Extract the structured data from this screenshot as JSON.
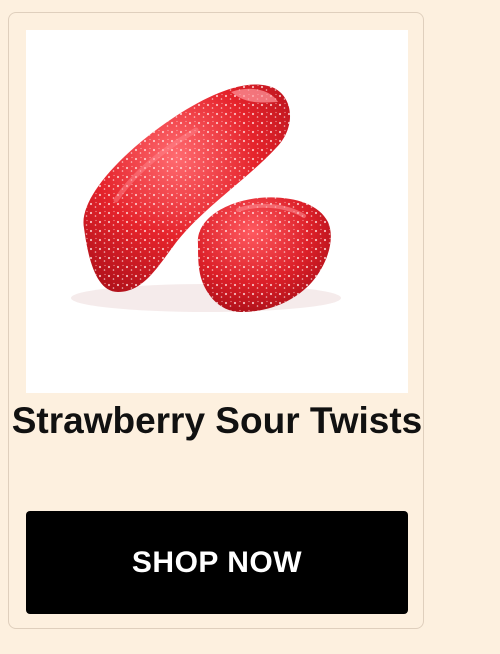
{
  "product": {
    "image_name": "strawberry-sour-twists-candy",
    "title": "Strawberry Sour Twists",
    "button_label": "SHOP NOW"
  },
  "colors": {
    "page_background": "#fdf0df",
    "card_border": "#dfcfbd",
    "image_background": "#ffffff",
    "candy_red": "#e5232b",
    "button_background": "#000000",
    "button_text": "#ffffff",
    "title_text": "#111111"
  }
}
